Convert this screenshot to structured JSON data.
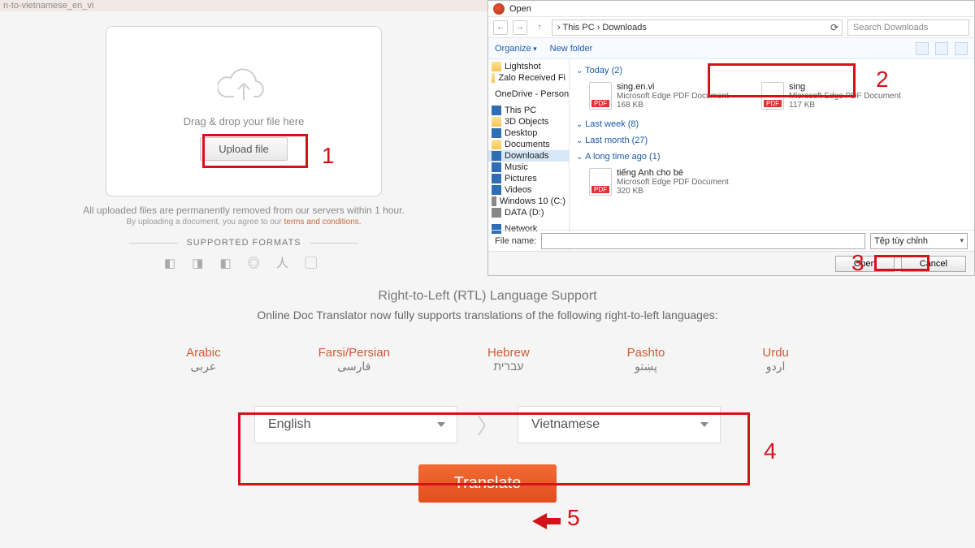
{
  "tab": {
    "title": "n-to-vietnamese_en_vi"
  },
  "upload": {
    "drag_text": "Drag & drop your file here",
    "button_label": "Upload file",
    "note_removed": "All uploaded files are permanently removed from our servers within 1 hour.",
    "note_agree_prefix": "By uploading a document, you agree to our ",
    "terms_label": "terms and conditions.",
    "supported_label": "SUPPORTED FORMATS"
  },
  "dialog": {
    "title": "Open",
    "breadcrumb": "› This PC › Downloads",
    "search_placeholder": "Search Downloads",
    "organize": "Organize",
    "new_folder": "New folder",
    "tree": {
      "lightshot": "Lightshot",
      "zalo": "Zalo Received Fi",
      "onedrive": "OneDrive - Person",
      "thispc": "This PC",
      "objects3d": "3D Objects",
      "desktop": "Desktop",
      "documents": "Documents",
      "downloads": "Downloads",
      "music": "Music",
      "pictures": "Pictures",
      "videos": "Videos",
      "win10": "Windows 10 (C:)",
      "data": "DATA (D:)",
      "network": "Network"
    },
    "groups": {
      "today": "Today (2)",
      "lastweek": "Last week (8)",
      "lastmonth": "Last month (27)",
      "longtime": "A long time ago (1)"
    },
    "files": {
      "f1": {
        "name": "sing.en.vi",
        "type": "Microsoft Edge PDF Document",
        "size": "168 KB"
      },
      "f2": {
        "name": "sing",
        "type": "Microsoft Edge PDF Document",
        "size": "117 KB"
      },
      "f3": {
        "name": "tiếng Anh cho bé",
        "type": "Microsoft Edge PDF Document",
        "size": "320 KB"
      }
    },
    "file_name_label": "File name:",
    "filter": "Tệp tùy chỉnh",
    "open_btn": "Open",
    "cancel_btn": "Cancel"
  },
  "rtl": {
    "title": "Right-to-Left (RTL) Language Support",
    "desc": "Online Doc Translator now fully supports translations of the following right-to-left languages:",
    "langs": [
      {
        "en": "Arabic",
        "native": "عربى"
      },
      {
        "en": "Farsi/Persian",
        "native": "فارسی"
      },
      {
        "en": "Hebrew",
        "native": "עברית"
      },
      {
        "en": "Pashto",
        "native": "پښتو"
      },
      {
        "en": "Urdu",
        "native": "اردو"
      }
    ]
  },
  "selector": {
    "from": "English",
    "to": "Vietnamese"
  },
  "translate_label": "Translate",
  "anno": {
    "n1": "1",
    "n2": "2",
    "n3": "3",
    "n4": "4",
    "n5": "5"
  }
}
